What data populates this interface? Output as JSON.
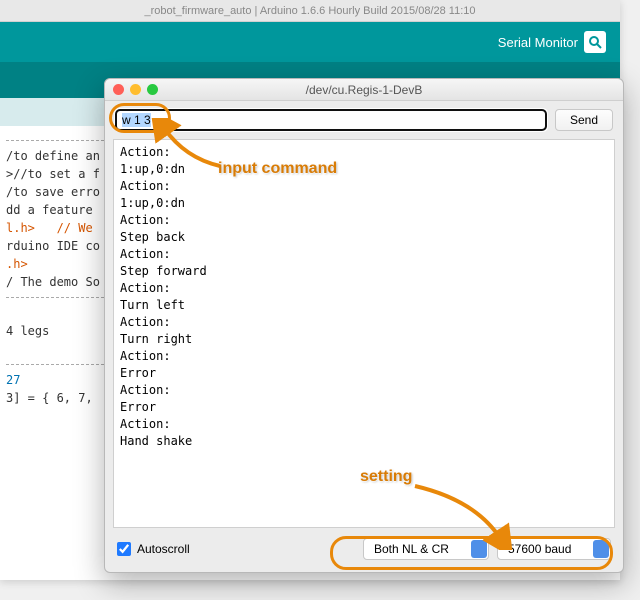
{
  "ide": {
    "title": "_robot_firmware_auto | Arduino 1.6.6 Hourly Build 2015/08/28 11:10",
    "serial_monitor_label": "Serial Monitor",
    "code_lines": [
      "",
      "/to define an",
      ">//to set a f",
      "/to save erro",
      "dd a feature ",
      "l.h>   // We ",
      "rduino IDE co",
      ".h>",
      "/ The demo So",
      "",
      "4 legs",
      "",
      "27",
      "3] = { 6, 7,"
    ]
  },
  "monitor": {
    "title": "/dev/cu.Regis-1-DevB",
    "input_value": "w 1 3",
    "send_label": "Send",
    "output": "Action:\n1:up,0:dn\nAction:\n1:up,0:dn\nAction:\nStep back\nAction:\nStep forward\nAction:\nTurn left\nAction:\nTurn right\nAction:\nError\nAction:\nError\nAction:\nHand shake",
    "autoscroll_label": "Autoscroll",
    "autoscroll_checked": true,
    "line_ending_value": "Both NL & CR",
    "baud_value": "57600 baud"
  },
  "annotations": {
    "input_command": "input command",
    "setting": "setting"
  }
}
